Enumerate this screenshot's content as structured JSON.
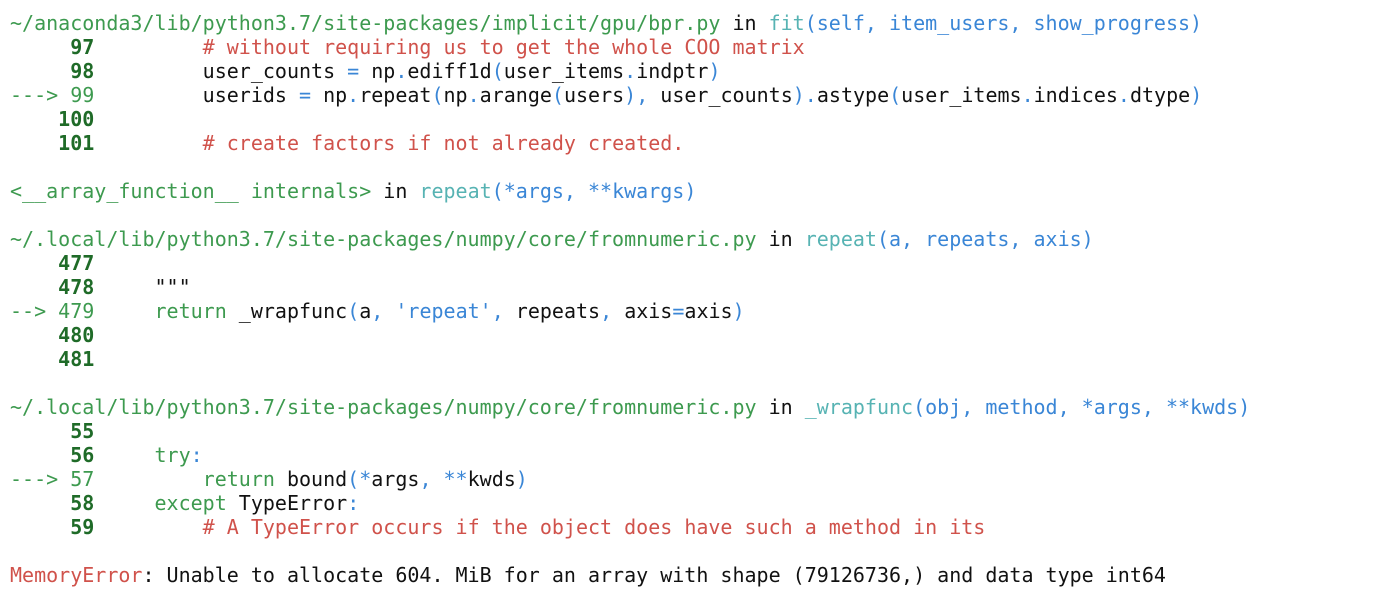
{
  "traceback": [
    {
      "kind": "header",
      "parts": [
        {
          "t": "~/anaconda3/lib/python3.7/site-packages/implicit/gpu/bpr.py",
          "c": "file"
        },
        {
          "t": " in ",
          "c": "plain"
        },
        {
          "t": "fit",
          "c": "func"
        },
        {
          "t": "(self, item_users, show_progress)",
          "c": "arg"
        }
      ]
    },
    {
      "kind": "code",
      "parts": [
        {
          "t": "     97",
          "c": "lnum"
        },
        {
          "t": "         ",
          "c": "plain"
        },
        {
          "t": "# without requiring us to get the whole COO matrix",
          "c": "cmt"
        }
      ]
    },
    {
      "kind": "code",
      "parts": [
        {
          "t": "     98",
          "c": "lnum"
        },
        {
          "t": "         user_counts ",
          "c": "plain"
        },
        {
          "t": "=",
          "c": "op"
        },
        {
          "t": " np",
          "c": "plain"
        },
        {
          "t": ".",
          "c": "op"
        },
        {
          "t": "ediff1d",
          "c": "plain"
        },
        {
          "t": "(",
          "c": "op"
        },
        {
          "t": "user_items",
          "c": "plain"
        },
        {
          "t": ".",
          "c": "op"
        },
        {
          "t": "indptr",
          "c": "plain"
        },
        {
          "t": ")",
          "c": "op"
        }
      ]
    },
    {
      "kind": "code",
      "parts": [
        {
          "t": "---> 99",
          "c": "arrow"
        },
        {
          "t": "         userids ",
          "c": "plain"
        },
        {
          "t": "=",
          "c": "op"
        },
        {
          "t": " np",
          "c": "plain"
        },
        {
          "t": ".",
          "c": "op"
        },
        {
          "t": "repeat",
          "c": "plain"
        },
        {
          "t": "(",
          "c": "op"
        },
        {
          "t": "np",
          "c": "plain"
        },
        {
          "t": ".",
          "c": "op"
        },
        {
          "t": "arange",
          "c": "plain"
        },
        {
          "t": "(",
          "c": "op"
        },
        {
          "t": "users",
          "c": "plain"
        },
        {
          "t": "),",
          "c": "op"
        },
        {
          "t": " user_counts",
          "c": "plain"
        },
        {
          "t": ").",
          "c": "op"
        },
        {
          "t": "astype",
          "c": "plain"
        },
        {
          "t": "(",
          "c": "op"
        },
        {
          "t": "user_items",
          "c": "plain"
        },
        {
          "t": ".",
          "c": "op"
        },
        {
          "t": "indices",
          "c": "plain"
        },
        {
          "t": ".",
          "c": "op"
        },
        {
          "t": "dtype",
          "c": "plain"
        },
        {
          "t": ")",
          "c": "op"
        }
      ]
    },
    {
      "kind": "code",
      "parts": [
        {
          "t": "    100",
          "c": "lnum"
        }
      ]
    },
    {
      "kind": "code",
      "parts": [
        {
          "t": "    101",
          "c": "lnum"
        },
        {
          "t": "         ",
          "c": "plain"
        },
        {
          "t": "# create factors if not already created.",
          "c": "cmt"
        }
      ]
    },
    {
      "kind": "blank",
      "parts": []
    },
    {
      "kind": "header",
      "parts": [
        {
          "t": "<__array_function__ internals>",
          "c": "file"
        },
        {
          "t": " in ",
          "c": "plain"
        },
        {
          "t": "repeat",
          "c": "func"
        },
        {
          "t": "(*args, **kwargs)",
          "c": "arg"
        }
      ]
    },
    {
      "kind": "blank",
      "parts": []
    },
    {
      "kind": "header",
      "parts": [
        {
          "t": "~/.local/lib/python3.7/site-packages/numpy/core/fromnumeric.py",
          "c": "file"
        },
        {
          "t": " in ",
          "c": "plain"
        },
        {
          "t": "repeat",
          "c": "func"
        },
        {
          "t": "(a, repeats, axis)",
          "c": "arg"
        }
      ]
    },
    {
      "kind": "code",
      "parts": [
        {
          "t": "    477",
          "c": "lnum"
        }
      ]
    },
    {
      "kind": "code",
      "parts": [
        {
          "t": "    478",
          "c": "lnum"
        },
        {
          "t": "     \"\"\"",
          "c": "plain"
        }
      ]
    },
    {
      "kind": "code",
      "parts": [
        {
          "t": "--> 479",
          "c": "arrow"
        },
        {
          "t": "     ",
          "c": "plain"
        },
        {
          "t": "return",
          "c": "kw"
        },
        {
          "t": " _wrapfunc",
          "c": "plain"
        },
        {
          "t": "(",
          "c": "op"
        },
        {
          "t": "a",
          "c": "plain"
        },
        {
          "t": ", ",
          "c": "op"
        },
        {
          "t": "'repeat'",
          "c": "str"
        },
        {
          "t": ", ",
          "c": "op"
        },
        {
          "t": "repeats",
          "c": "plain"
        },
        {
          "t": ", ",
          "c": "op"
        },
        {
          "t": "axis",
          "c": "plain"
        },
        {
          "t": "=",
          "c": "op"
        },
        {
          "t": "axis",
          "c": "plain"
        },
        {
          "t": ")",
          "c": "op"
        }
      ]
    },
    {
      "kind": "code",
      "parts": [
        {
          "t": "    480",
          "c": "lnum"
        }
      ]
    },
    {
      "kind": "code",
      "parts": [
        {
          "t": "    481",
          "c": "lnum"
        }
      ]
    },
    {
      "kind": "blank",
      "parts": []
    },
    {
      "kind": "header",
      "parts": [
        {
          "t": "~/.local/lib/python3.7/site-packages/numpy/core/fromnumeric.py",
          "c": "file"
        },
        {
          "t": " in ",
          "c": "plain"
        },
        {
          "t": "_wrapfunc",
          "c": "func"
        },
        {
          "t": "(obj, method, *args, **kwds)",
          "c": "arg"
        }
      ]
    },
    {
      "kind": "code",
      "parts": [
        {
          "t": "     55",
          "c": "lnum"
        }
      ]
    },
    {
      "kind": "code",
      "parts": [
        {
          "t": "     56",
          "c": "lnum"
        },
        {
          "t": "     ",
          "c": "plain"
        },
        {
          "t": "try",
          "c": "kw"
        },
        {
          "t": ":",
          "c": "op"
        }
      ]
    },
    {
      "kind": "code",
      "parts": [
        {
          "t": "---> 57",
          "c": "arrow"
        },
        {
          "t": "         ",
          "c": "plain"
        },
        {
          "t": "return",
          "c": "kw"
        },
        {
          "t": " bound",
          "c": "plain"
        },
        {
          "t": "(*",
          "c": "op"
        },
        {
          "t": "args",
          "c": "plain"
        },
        {
          "t": ", **",
          "c": "op"
        },
        {
          "t": "kwds",
          "c": "plain"
        },
        {
          "t": ")",
          "c": "op"
        }
      ]
    },
    {
      "kind": "code",
      "parts": [
        {
          "t": "     58",
          "c": "lnum"
        },
        {
          "t": "     ",
          "c": "plain"
        },
        {
          "t": "except",
          "c": "kw"
        },
        {
          "t": " TypeError",
          "c": "plain"
        },
        {
          "t": ":",
          "c": "op"
        }
      ]
    },
    {
      "kind": "code",
      "parts": [
        {
          "t": "     59",
          "c": "lnum"
        },
        {
          "t": "         ",
          "c": "plain"
        },
        {
          "t": "# A TypeError occurs if the object does have such a method in its",
          "c": "cmt"
        }
      ]
    },
    {
      "kind": "blank",
      "parts": []
    },
    {
      "kind": "error",
      "parts": [
        {
          "t": "MemoryError",
          "c": "errname"
        },
        {
          "t": ": Unable to allocate 604. MiB for an array with shape (79126736,) and data type int64",
          "c": "plain"
        }
      ]
    }
  ],
  "colors": {
    "file": "#3d9a4f",
    "func": "#57b3b3",
    "arg": "#3a86d6",
    "comment": "#d0524b",
    "line_number": "#1f6b28",
    "error_name": "#d0524b"
  }
}
